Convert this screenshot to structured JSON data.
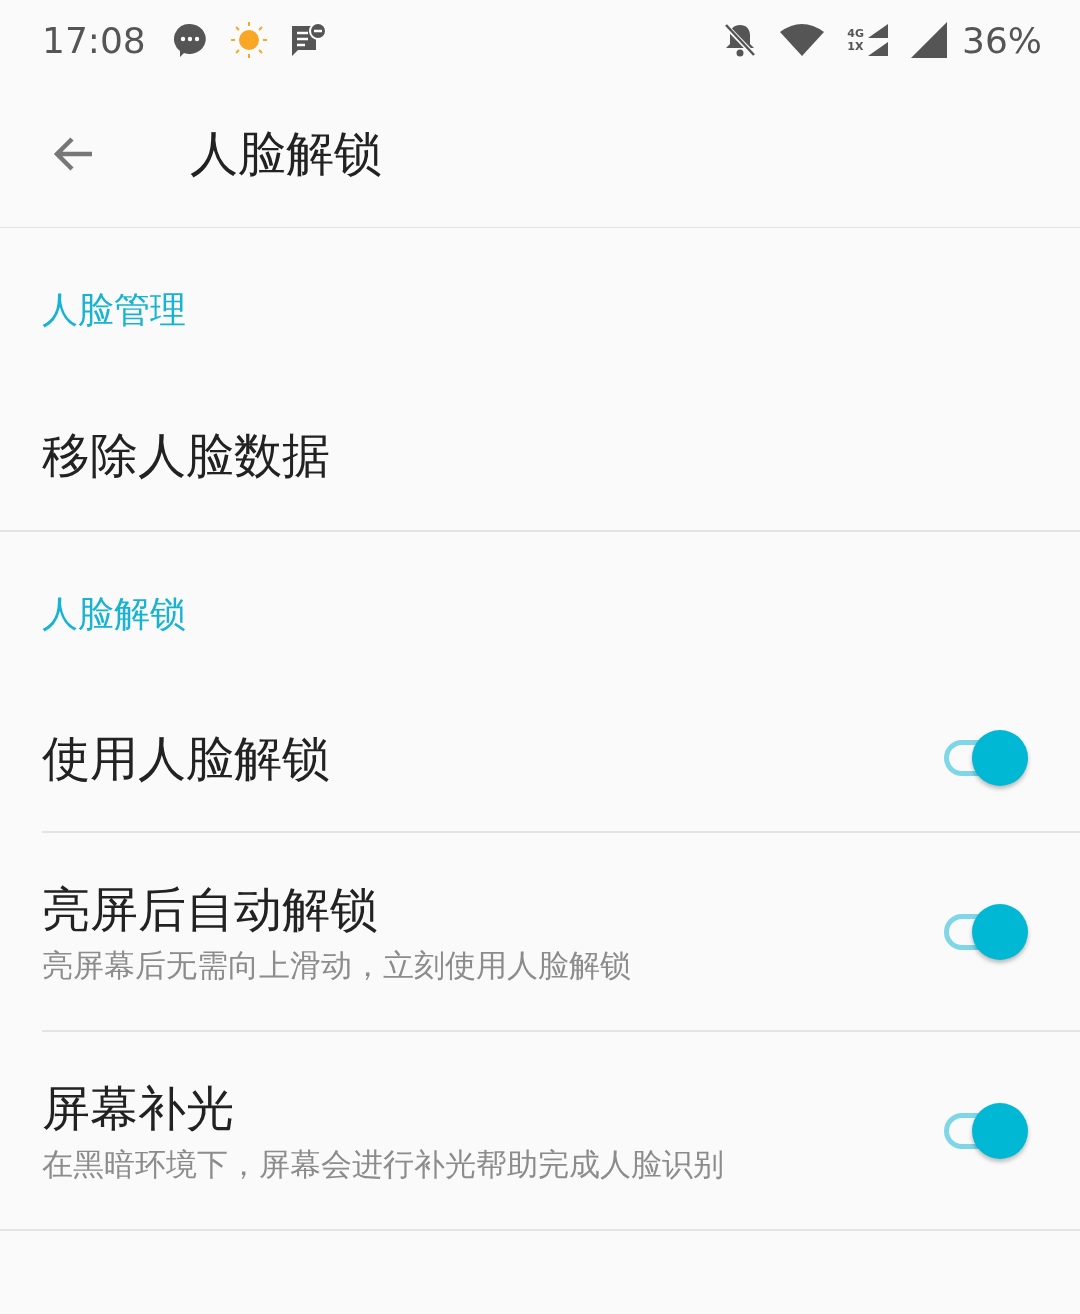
{
  "status_bar": {
    "time": "17:08",
    "network_top": "4G",
    "network_bottom": "1X",
    "battery": "36%"
  },
  "app_bar": {
    "title": "人脸解锁"
  },
  "sections": [
    {
      "header": "人脸管理",
      "items": [
        {
          "kind": "action",
          "title": "移除人脸数据"
        }
      ]
    },
    {
      "header": "人脸解锁",
      "items": [
        {
          "kind": "switch",
          "title": "使用人脸解锁",
          "on": true
        },
        {
          "kind": "switch",
          "title": "亮屏后自动解锁",
          "subtitle": "亮屏幕后无需向上滑动，立刻使用人脸解锁",
          "on": true
        },
        {
          "kind": "switch",
          "title": "屏幕补光",
          "subtitle": "在黑暗环境下，屏幕会进行补光帮助完成人脸识别",
          "on": true
        }
      ]
    }
  ]
}
